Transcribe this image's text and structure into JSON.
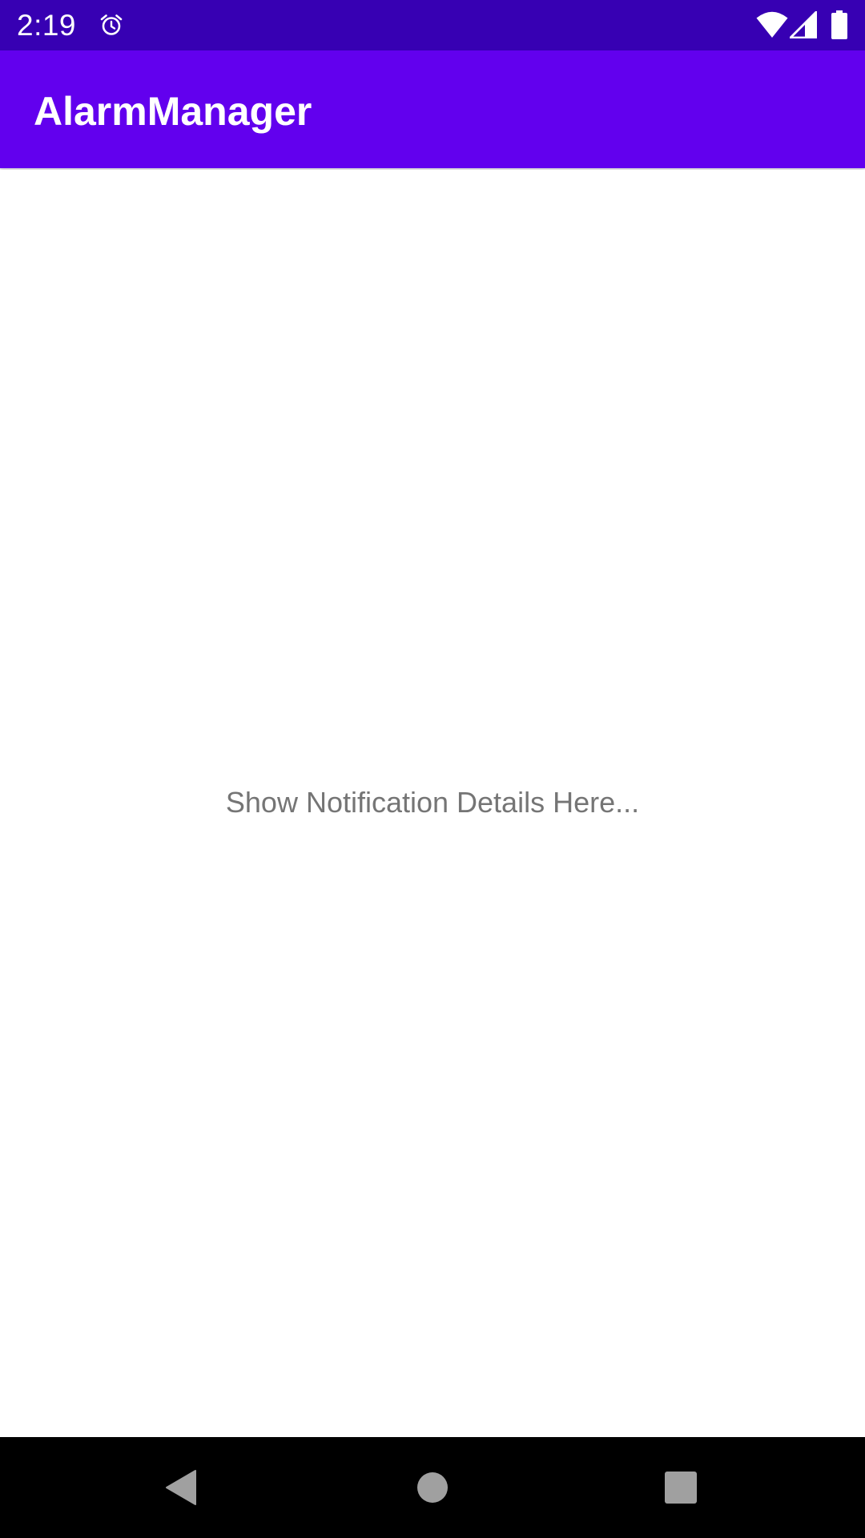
{
  "status_bar": {
    "time": "2:19",
    "icons": [
      "alarm-icon",
      "wifi-icon",
      "signal-icon",
      "battery-icon"
    ],
    "background": "#3700b3"
  },
  "app_bar": {
    "title": "AlarmManager",
    "background": "#6200ee"
  },
  "main": {
    "notification_text": "Show Notification Details Here..."
  },
  "nav_bar": {
    "buttons": [
      "back-icon",
      "home-icon",
      "recents-icon"
    ],
    "background": "#000000"
  }
}
